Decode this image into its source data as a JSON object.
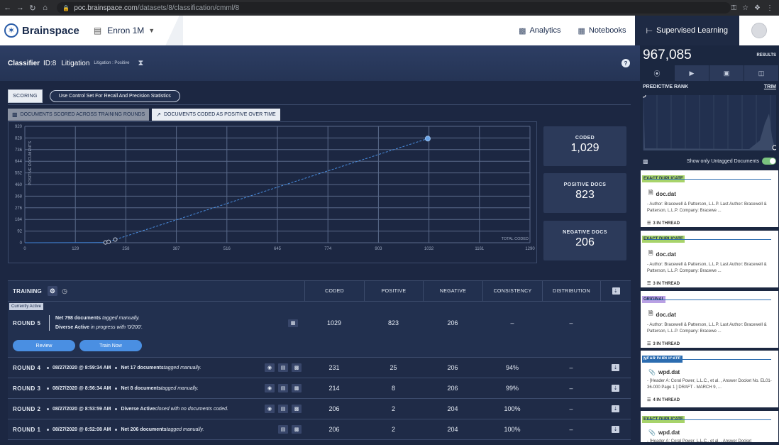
{
  "browser": {
    "url_host": "poc.brainspace.com",
    "url_path": "/datasets/8/classification/cmml/8"
  },
  "app": {
    "brand": "Brainspace",
    "dataset": "Enron 1M",
    "nav": {
      "analytics": "Analytics",
      "notebooks": "Notebooks",
      "supervised": "Supervised Learning"
    }
  },
  "classifier": {
    "label": "Classifier",
    "id": "ID:8",
    "name": "Litigation",
    "sub": "Litigation : Positive"
  },
  "controls": {
    "scoring": "SCORING",
    "control_set": "Use Control Set For Recall And Precision Statistics",
    "tab_rounds": "DOCUMENTS SCORED ACROSS TRAINING ROUNDS",
    "tab_time": "DOCUMENTS CODED AS POSITIVE OVER TIME"
  },
  "chart_data": {
    "type": "line",
    "ylabel": "POSITIVE DOCUMENTS",
    "xlabel": "TOTAL CODED",
    "x_ticks": [
      0,
      129,
      258,
      387,
      516,
      645,
      774,
      903,
      1032,
      1161,
      1290
    ],
    "y_ticks": [
      0,
      92,
      184,
      276,
      368,
      460,
      552,
      644,
      736,
      828,
      920
    ],
    "xlim": [
      0,
      1290
    ],
    "ylim": [
      0,
      920
    ],
    "grid": true,
    "series": [
      {
        "points": [
          [
            206,
            2
          ],
          [
            214,
            8
          ],
          [
            231,
            25
          ],
          [
            1029,
            823
          ]
        ],
        "style": "dashed"
      }
    ]
  },
  "stats": {
    "coded_label": "CODED",
    "coded_value": "1,029",
    "positive_label": "POSITIVE DOCS",
    "positive_value": "823",
    "negative_label": "NEGATIVE DOCS",
    "negative_value": "206"
  },
  "training": {
    "title": "TRAINING",
    "headers": {
      "coded": "CODED",
      "positive": "POSITIVE",
      "negative": "NEGATIVE",
      "consistency": "CONSISTENCY",
      "distribution": "DISTRIBUTION"
    },
    "currently_active": "Currently Active",
    "round5": {
      "name": "ROUND 5",
      "line1_bold": "Net 798 documents",
      "line1_rest": " tagged manually.",
      "line2_bold": "Diverse Active",
      "line2_rest": " in progress with '0/200'.",
      "coded": "1029",
      "positive": "823",
      "negative": "206",
      "consistency": "–",
      "distribution": "–"
    },
    "review_btn": "Review",
    "train_btn": "Train Now",
    "rounds": [
      {
        "name": "ROUND 4",
        "ts": "08/27/2020 @ 8:59:34 AM",
        "bold": "Net 17 documents",
        "rest": " tagged manually.",
        "coded": "231",
        "positive": "25",
        "negative": "206",
        "consistency": "94%",
        "distribution": "–"
      },
      {
        "name": "ROUND 3",
        "ts": "08/27/2020 @ 8:56:34 AM",
        "bold": "Net 8 documents",
        "rest": " tagged manually.",
        "coded": "214",
        "positive": "8",
        "negative": "206",
        "consistency": "99%",
        "distribution": "–"
      },
      {
        "name": "ROUND 2",
        "ts": "08/27/2020 @ 8:53:59 AM",
        "bold": "Diverse Active",
        "rest": " closed with no documents coded.",
        "coded": "206",
        "positive": "2",
        "negative": "204",
        "consistency": "100%",
        "distribution": "–"
      },
      {
        "name": "ROUND 1",
        "ts": "08/27/2020 @ 8:52:08 AM",
        "bold": "Net 206 documents",
        "rest": " tagged manually.",
        "coded": "206",
        "positive": "2",
        "negative": "204",
        "consistency": "100%",
        "distribution": "–"
      }
    ]
  },
  "sidebar": {
    "count": "967,085",
    "results_label": "RESULTS",
    "predictive_rank": "PREDICTIVE RANK",
    "trim": "TRIM",
    "untagged": "Show only Untagged Documents",
    "untagged_on": true,
    "cards": [
      {
        "tag": "EXACT DUPLICATE",
        "file": "doc.dat",
        "meta": "- Author: Bracewell & Patterson, L.L.P. Last Author: Bracewell & Patterson, L.L.P. Company: Bracewe ...",
        "thread": "3 IN THREAD"
      },
      {
        "tag": "EXACT DUPLICATE",
        "file": "doc.dat",
        "meta": "- Author: Bracewell & Patterson, L.L.P. Last Author: Bracewell & Patterson, L.L.P. Company: Bracewe ...",
        "thread": "3 IN THREAD"
      },
      {
        "tag": "ORIGINAL",
        "file": "doc.dat",
        "meta": "- Author: Bracewell & Patterson, L.L.P. Last Author: Bracewell & Patterson, L.L.P. Company: Bracewe ...",
        "thread": "3 IN THREAD"
      },
      {
        "tag": "NEAR DUPLICATE",
        "file": "wpd.dat",
        "meta": "- [Header A: Coral Power, L.L.C., et al. , Answer Docket No. EL01-36-000 Page 1 ] DRAFT - MARCH 9, ...",
        "thread": "4 IN THREAD"
      },
      {
        "tag": "EXACT DUPLICATE",
        "file": "wpd.dat",
        "meta": "- [Header A: Coral Power, L.L.C., et al. , Answer Docket",
        "thread": ""
      }
    ]
  }
}
